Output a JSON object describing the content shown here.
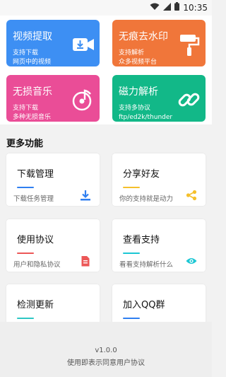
{
  "status_bar": {
    "time": "10:35",
    "icons": [
      "wifi-icon",
      "signal-icon",
      "battery-icon"
    ]
  },
  "tiles": [
    {
      "title": "视频提取",
      "desc_line1": "支持下载",
      "desc_line2": "网页中的视频",
      "icon": "video-download-icon",
      "color": "#3d8ff3"
    },
    {
      "title": "无痕去水印",
      "desc_line1": "支持解析",
      "desc_line2": "众多视频平台",
      "icon": "paint-roller-icon",
      "color": "#f0763a"
    },
    {
      "title": "无损音乐",
      "desc_line1": "支持下载",
      "desc_line2": "多种无损音乐",
      "icon": "music-disc-icon",
      "color": "#ea4d97"
    },
    {
      "title": "磁力解析",
      "desc_line1": "支持多协议",
      "desc_line2": "ftp/ed2k/thunder",
      "icon": "link-icon",
      "color": "#12b888"
    }
  ],
  "more_title": "更多功能",
  "cards": [
    {
      "title": "下载管理",
      "desc": "下载任务管理",
      "icon": "download-icon",
      "accent": "#2f7ff0"
    },
    {
      "title": "分享好友",
      "desc": "你的支持就是动力",
      "icon": "share-icon",
      "accent": "#f5c02c"
    },
    {
      "title": "使用协议",
      "desc": "用户和隐私协议",
      "icon": "document-icon",
      "accent": "#ec5757"
    },
    {
      "title": "查看支持",
      "desc": "看看支持解析什么",
      "icon": "eye-icon",
      "accent": "#1cc7d4"
    },
    {
      "title": "检测更新",
      "desc": "",
      "icon": "",
      "accent": "#2ec7c4"
    },
    {
      "title": "加入QQ群",
      "desc": "",
      "icon": "",
      "accent": "#2f7ff0"
    }
  ],
  "footer": {
    "version": "v1.0.0",
    "notice": "使用即表示同意用户协议"
  }
}
